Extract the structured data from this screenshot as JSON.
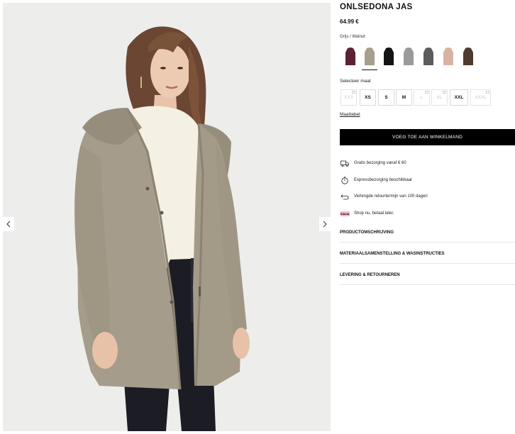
{
  "product": {
    "title": "ONLSEDONA JAS",
    "price": "64.99 €",
    "color_label": "Grijs / Walnut",
    "colors": [
      {
        "name": "burgundy",
        "hex": "#5a2232",
        "selected": false
      },
      {
        "name": "grijs-walnut",
        "hex": "#a89e8c",
        "selected": true
      },
      {
        "name": "black",
        "hex": "#141414",
        "selected": false
      },
      {
        "name": "light-grey",
        "hex": "#9a9a9a",
        "selected": false
      },
      {
        "name": "dark-grey",
        "hex": "#5c5c5e",
        "selected": false
      },
      {
        "name": "pink",
        "hex": "#d9b2a6",
        "selected": false
      },
      {
        "name": "brown",
        "hex": "#4e3a2e",
        "selected": false
      }
    ]
  },
  "size_section": {
    "label": "Selecteer maat",
    "sizes": [
      {
        "label": "XXS",
        "available": false
      },
      {
        "label": "XS",
        "available": true
      },
      {
        "label": "S",
        "available": true
      },
      {
        "label": "M",
        "available": true
      },
      {
        "label": "L",
        "available": false
      },
      {
        "label": "XL",
        "available": false
      },
      {
        "label": "XXL",
        "available": true
      },
      {
        "label": "XXXL",
        "available": false
      }
    ],
    "guide_label": "Maattabel"
  },
  "cta": {
    "add_to_cart": "VOEG TOE AAN WINKELMAND"
  },
  "usps": [
    {
      "icon": "truck-icon",
      "text": "Gratis bezorging vanaf € 60"
    },
    {
      "icon": "stopwatch-icon",
      "text": "Expressbezorging beschikbaar"
    },
    {
      "icon": "return-arrow-icon",
      "text": "Verlengde retourtermijn van 100 dagen"
    },
    {
      "icon": "klarna-icon",
      "badge": "Klarna",
      "text": "Shop nu, betaal later."
    }
  ],
  "accordions": [
    {
      "label": "PRODUCTOMSCHRIJVING"
    },
    {
      "label": "MATERIAALSAMENSTELLING & WASINSTRUCTIES"
    },
    {
      "label": "LEVERING & RETOURNEREN"
    }
  ],
  "gallery": {
    "prev_icon": "chevron-left-icon",
    "next_icon": "chevron-right-icon",
    "background": "#ededeb"
  }
}
